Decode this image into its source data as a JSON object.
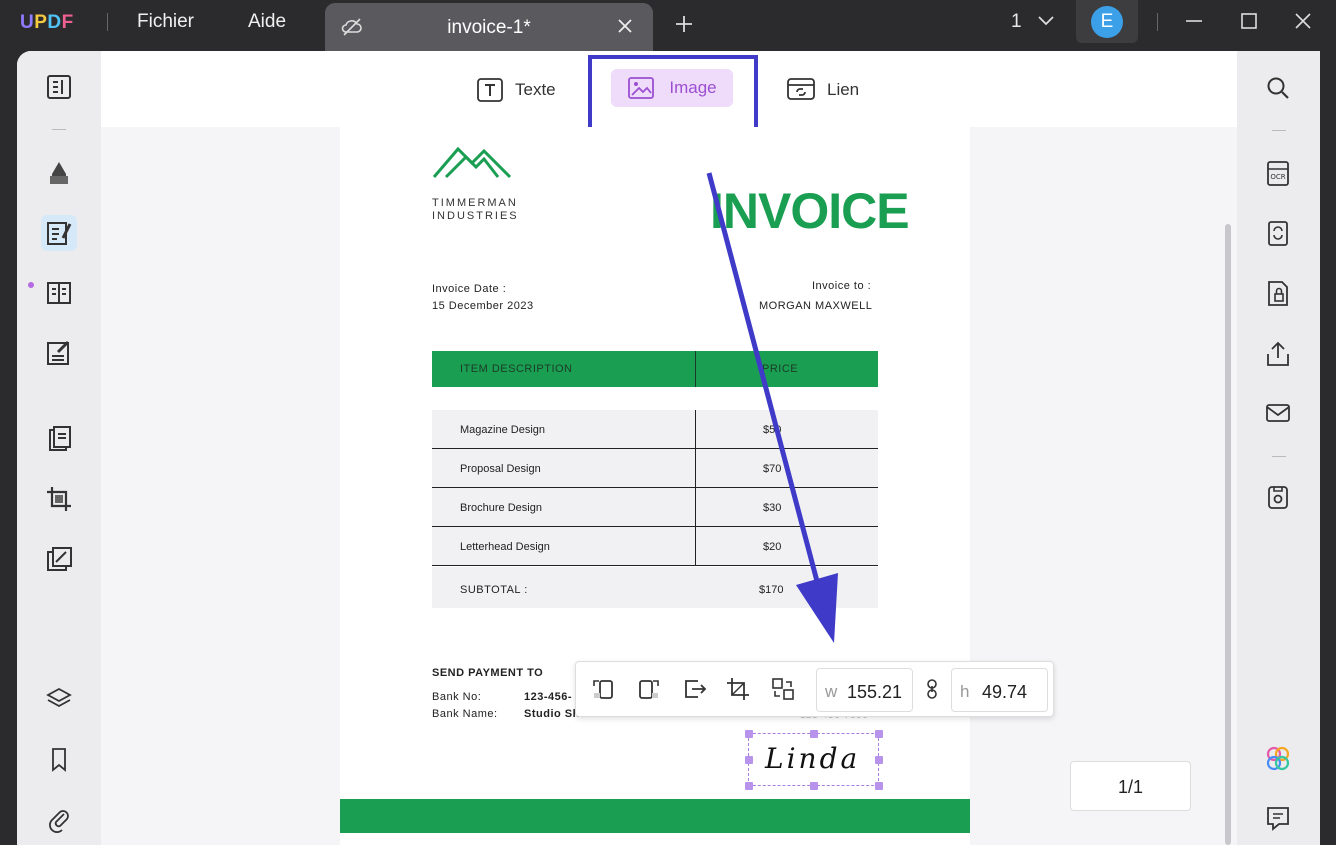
{
  "app": {
    "logo": "UPDF",
    "logo_colors": [
      "#6a5cf5",
      "#f0c437",
      "#4fc3f7",
      "#e4507a"
    ],
    "menu": [
      "Fichier",
      "Aide"
    ]
  },
  "tab": {
    "title": "invoice-1*"
  },
  "header": {
    "page_selector": "1",
    "avatar_letter": "E"
  },
  "toolbar": {
    "text_label": "Texte",
    "image_label": "Image",
    "link_label": "Lien"
  },
  "document": {
    "company_line1": "TIMMERMAN",
    "company_line2": "INDUSTRIES",
    "title": "INVOICE",
    "date_label": "Invoice Date :",
    "date_value": "15 December 2023",
    "to_label": "Invoice to :",
    "to_value": "MORGAN MAXWELL",
    "col_item": "ITEM DESCRIPTION",
    "col_price": "PRICE",
    "rows": [
      {
        "item": "Magazine Design",
        "price": "$50"
      },
      {
        "item": "Proposal Design",
        "price": "$70"
      },
      {
        "item": "Brochure Design",
        "price": "$30"
      },
      {
        "item": "Letterhead Design",
        "price": "$20"
      }
    ],
    "subtotal_label": "SUBTOTAL :",
    "subtotal_value": "$170",
    "payment_heading": "SEND PAYMENT TO",
    "bank_no_label": "Bank No:",
    "bank_no_value": "123-456-",
    "bank_name_label": "Bank Name:",
    "bank_name_value": "Studio Sh",
    "phone_partial": "123-456-7890",
    "signature": "Linda",
    "accent_color": "#1a9e52"
  },
  "image_toolbar": {
    "w_label": "w",
    "w_value": "155.21",
    "h_label": "h",
    "h_value": "49.74"
  },
  "page_indicator": "1/1",
  "annotation_color": "#3f3bc8"
}
